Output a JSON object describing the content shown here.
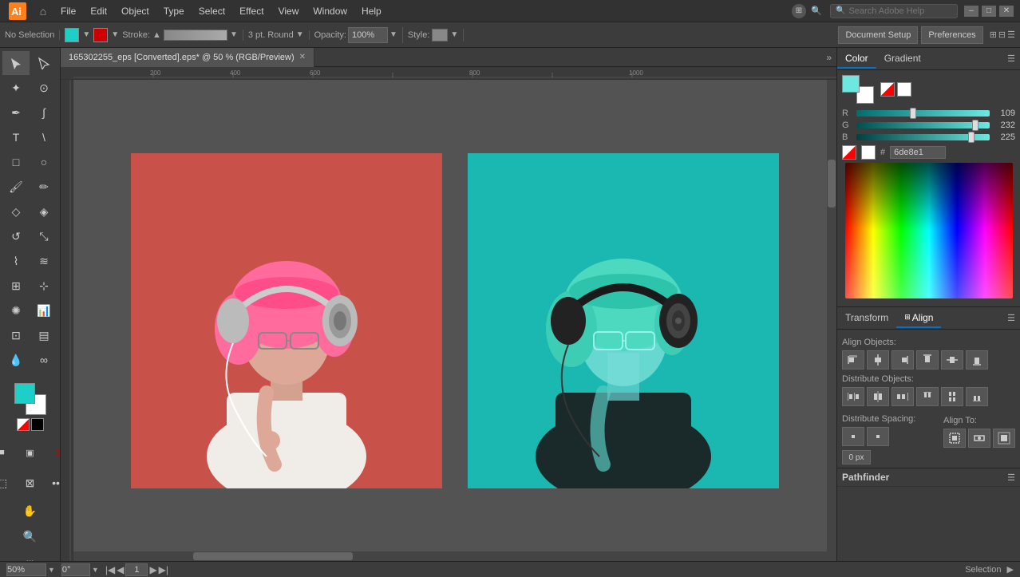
{
  "app": {
    "title": "Adobe Illustrator",
    "logo": "Ai"
  },
  "menu": {
    "items": [
      "File",
      "Edit",
      "Object",
      "Type",
      "Select",
      "Effect",
      "View",
      "Window",
      "Help"
    ]
  },
  "search": {
    "placeholder": "Search Adobe Help",
    "value": ""
  },
  "toolbar_top": {
    "no_selection": "No Selection",
    "stroke_label": "Stroke:",
    "stroke_value": "3 pt. Round",
    "opacity_label": "Opacity:",
    "opacity_value": "100%",
    "style_label": "Style:",
    "document_setup_btn": "Document Setup",
    "preferences_btn": "Preferences"
  },
  "document": {
    "tab_title": "165302255_eps [Converted].eps* @ 50 % (RGB/Preview)",
    "zoom": "50%",
    "rotation": "0°",
    "page": "1",
    "status": "Selection"
  },
  "color_panel": {
    "tab_color": "Color",
    "tab_gradient": "Gradient",
    "r_label": "R",
    "r_value": "109",
    "g_label": "G",
    "g_value": "232",
    "b_label": "B",
    "b_value": "225",
    "hex_label": "#",
    "hex_value": "6de8e1",
    "r_percent": 43,
    "g_percent": 91,
    "b_percent": 88
  },
  "align_panel": {
    "tab_transform": "Transform",
    "tab_align": "Align",
    "align_objects_label": "Align Objects:",
    "distribute_objects_label": "Distribute Objects:",
    "distribute_spacing_label": "Distribute Spacing:",
    "align_to_label": "Align To:",
    "spacing_value": "0 px"
  },
  "pathfinder": {
    "title": "Pathfinder"
  },
  "tools": {
    "list": [
      "selection",
      "direct-selection",
      "magic-wand",
      "lasso",
      "pen",
      "curvature",
      "type",
      "line",
      "rectangle",
      "ellipse",
      "paintbrush",
      "pencil",
      "shaper",
      "rotate",
      "scale",
      "width",
      "warp",
      "free-transform",
      "symbol-sprayer",
      "column-graph",
      "mesh",
      "gradient",
      "eyedropper",
      "blend",
      "artboard",
      "slice",
      "hand",
      "zoom"
    ]
  }
}
